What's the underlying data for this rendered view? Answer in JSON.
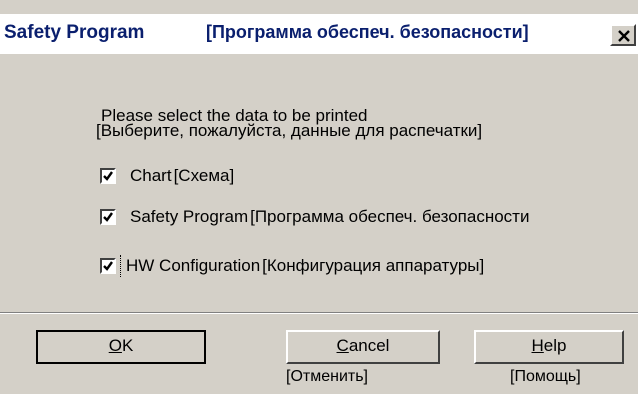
{
  "window": {
    "title": "Safety Program",
    "title_ru": "[Программа обеспеч. безопасности]",
    "close_glyph": "×"
  },
  "prompt": {
    "text": "Please select the data to be printed",
    "text_ru": "[Выберите, пожалуйста, данные для распечатки]"
  },
  "options": [
    {
      "label": "Chart",
      "label_ru": "[Схема]",
      "checked": true
    },
    {
      "label": "Safety Program",
      "label_ru": "[Программа обеспеч. безопасности",
      "checked": true
    },
    {
      "label": "HW Configuration",
      "label_ru": "[Конфигурация аппаратуры]",
      "checked": true
    }
  ],
  "buttons": {
    "ok": {
      "label": "OK",
      "mnemonic": "O",
      "rest": "K"
    },
    "cancel": {
      "label": "Cancel",
      "mnemonic": "C",
      "rest": "ancel",
      "label_ru": "[Отменить]"
    },
    "help": {
      "label": "Help",
      "mnemonic": "H",
      "rest": "elp",
      "label_ru": "[Помощь]"
    }
  },
  "colors": {
    "dialog_bg": "#d4d0c8",
    "title_text": "#0a1f6e"
  }
}
